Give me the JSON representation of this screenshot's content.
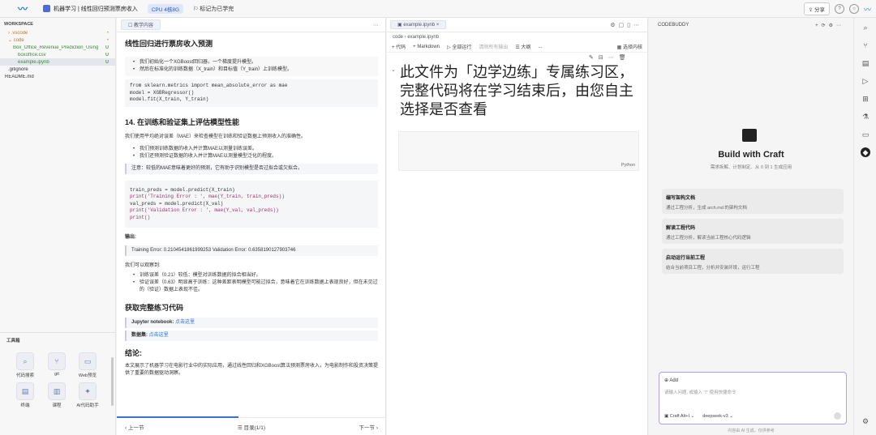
{
  "topbar": {
    "title": "机器学习 | 线性回归预测票房收入",
    "cpu": "CPU 4核8G",
    "mark_done": "标记为已学完",
    "share": "分享"
  },
  "explorer": {
    "header": "WORKSPACE",
    "items": [
      {
        "label": "› .vscode",
        "status": "•"
      },
      {
        "label": "⌄ code",
        "status": "•"
      },
      {
        "label": "Box_Office_Revenue_Prediction_Using...",
        "status": "U"
      },
      {
        "label": "boxoffice.csv",
        "status": "U"
      },
      {
        "label": "example.ipynb",
        "status": "U"
      },
      {
        "label": ".gitignore",
        "status": ""
      },
      {
        "label": "README.md",
        "status": ""
      }
    ],
    "toolbox_header": "工具箱",
    "tools": [
      "代码搜索",
      "git",
      "Web预览",
      "终端",
      "课程",
      "AI代码助手"
    ]
  },
  "article": {
    "tab": "教学内容",
    "title1": "线性回归进行票房收入预测",
    "list1": [
      "我们初始化一个XGBoost回归器，一个梯度提升模型。",
      "然后在标准化的训练数据（X_train）和目标值（Y_train）上训练模型。"
    ],
    "code1": [
      "from sklearn.metrics import mean_absolute_error as mae",
      "model = XGBRegressor()",
      "model.fit(X_train, Y_train)"
    ],
    "title2": "14. 在训练和验证集上评估模型性能",
    "p1": "我们使用平均绝对误差（MAE）来检查模型在训练和验证数据上预测收入的准确性。",
    "list2": [
      "我们预测训练数据的收入并计算MAE以测量训练误差。",
      "我们还预测验证数据的收入并计算MAE以测量模型泛化的程度。"
    ],
    "note": "注意：较低的MAE意味着更好的预测，它有助于识别模型是否过拟合或欠拟合。",
    "code2": [
      "train_preds = model.predict(X_train)",
      "print('Training Error : ', mae(Y_train, train_preds))",
      "val_preds = model.predict(X_val)",
      "print('Validation Error : ', mae(Y_val, val_preds))",
      "print()"
    ],
    "output_label": "输出:",
    "output": "Training Error: 0.2104541861999253 Validation Error: 0.6358190127903746",
    "observe": "我们可以观察到:",
    "list3": [
      "训练误差（0.21）较低：模型对训练数据的拟合相当好。",
      "验证误差（0.63）明显高于训练：这种差距表明模型可能过拟合，意味着它在训练数据上表现良好，但在未见过的（验证）数据上表现不佳。"
    ],
    "title3": "获取完整练习代码",
    "jupyter_label": "Jupyter notebook:",
    "jupyter_link": "点击这里",
    "dataset_label": "数据集:",
    "dataset_link": "点击这里",
    "title4": "结论:",
    "conclusion": "本文展示了机器学习在电影行业中的实际应用，通过线性回归和XGBoost算法预测票房收入，为电影制作和投资决策提供了重要的数据驱动洞察。",
    "prev": "‹ 上一节",
    "toc": "☰ 目录(1/1)",
    "next": "下一节 ›"
  },
  "notebook": {
    "tab": "example.ipynb",
    "crumb": "code › example.ipynb",
    "toolbar": [
      "+ 代码",
      "+ Markdown",
      "▷ 全部运行",
      "清除所有输出",
      "☰ 大纲",
      "..."
    ],
    "kernel": "选择内核",
    "markdown": "此文件为「边学边练」专属练习区，完整代码将在学习结束后，由您自主选择是否查看",
    "lang": "Python"
  },
  "assistant": {
    "header": "CODEBUDDY",
    "craft_title": "Build with Craft",
    "craft_sub": "需求拆解、计划制定、从 0 到 1 生成应用",
    "cards": [
      {
        "title": "编写架构文档",
        "desc": "通过工程分析，生成 arch.md 的架构文档"
      },
      {
        "title": "解读工程代码",
        "desc": "通过工程分析，解读当前工程核心代码逻辑"
      },
      {
        "title": "启动运行当前工程",
        "desc": "结合当前项目工程，分析并安装环境，运行工程"
      }
    ],
    "add": "Add",
    "placeholder": "请输入问题, 或输入 \"/\" 使用快捷命令",
    "mode": "Craft  Alt+I",
    "model": "deepseek-v3",
    "disclaimer": "内容由 AI 生成，仅供参考"
  },
  "colors": {
    "accent": "#2b6ee0",
    "highlight": "#a8a1f5"
  }
}
